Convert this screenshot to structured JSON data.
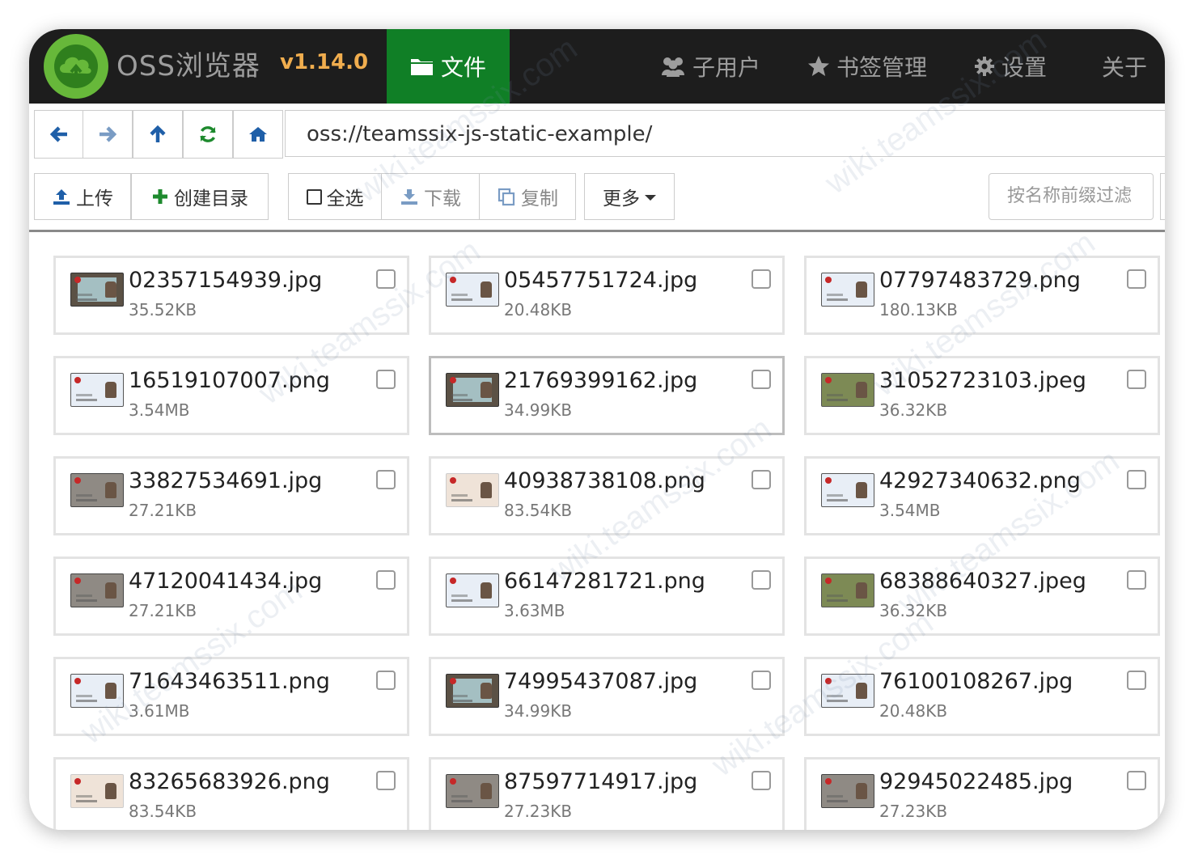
{
  "app": {
    "name": "OSS浏览器",
    "version": "v1.14.0"
  },
  "nav": {
    "files": "文件",
    "subusers": "子用户",
    "bookmarks": "书签管理",
    "settings": "设置",
    "about": "关于"
  },
  "address": {
    "path": "oss://teamssix-js-static-example/"
  },
  "toolbar": {
    "upload": "上传",
    "mkdir": "创建目录",
    "select_all": "全选",
    "download": "下载",
    "copy": "复制",
    "more": "更多",
    "filter_placeholder": "按名称前缀过滤"
  },
  "watermark": "wiki.teamssix.com",
  "files": [
    {
      "name": "02357154939.jpg",
      "size": "35.52KB",
      "thumb": "dark"
    },
    {
      "name": "05457751724.jpg",
      "size": "20.48KB",
      "thumb": "light"
    },
    {
      "name": "07797483729.png",
      "size": "180.13KB",
      "thumb": "light"
    },
    {
      "name": "16519107007.png",
      "size": "3.54MB",
      "thumb": "light"
    },
    {
      "name": "21769399162.jpg",
      "size": "34.99KB",
      "thumb": "dark",
      "selected": true
    },
    {
      "name": "31052723103.jpeg",
      "size": "36.32KB",
      "thumb": "green"
    },
    {
      "name": "33827534691.jpg",
      "size": "27.21KB",
      "thumb": "gray"
    },
    {
      "name": "40938738108.png",
      "size": "83.54KB",
      "thumb": "warm"
    },
    {
      "name": "42927340632.png",
      "size": "3.54MB",
      "thumb": "light"
    },
    {
      "name": "47120041434.jpg",
      "size": "27.21KB",
      "thumb": "gray"
    },
    {
      "name": "66147281721.png",
      "size": "3.63MB",
      "thumb": "light"
    },
    {
      "name": "68388640327.jpeg",
      "size": "36.32KB",
      "thumb": "green"
    },
    {
      "name": "71643463511.png",
      "size": "3.61MB",
      "thumb": "light"
    },
    {
      "name": "74995437087.jpg",
      "size": "34.99KB",
      "thumb": "dark"
    },
    {
      "name": "76100108267.jpg",
      "size": "20.48KB",
      "thumb": "light"
    },
    {
      "name": "83265683926.png",
      "size": "83.54KB",
      "thumb": "warm"
    },
    {
      "name": "87597714917.jpg",
      "size": "27.23KB",
      "thumb": "gray"
    },
    {
      "name": "92945022485.jpg",
      "size": "27.23KB",
      "thumb": "gray"
    }
  ],
  "colors": {
    "navbar": "#1d1d1d",
    "active_tab": "#107f26",
    "version": "#f0ad4e",
    "icon_blue": "#1f5fa8",
    "icon_green": "#1e8a2e"
  }
}
